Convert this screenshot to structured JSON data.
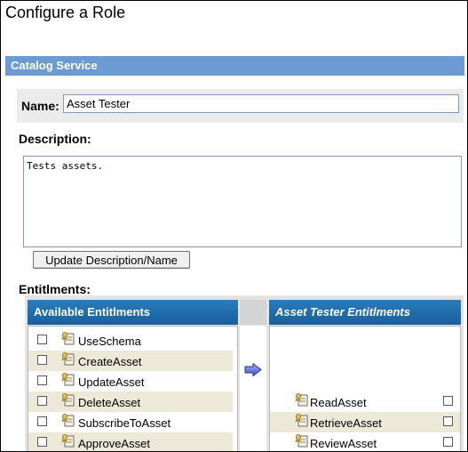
{
  "page_title": "Configure a Role",
  "section_title": "Catalog Service",
  "name": {
    "label": "Name:",
    "value": "Asset Tester"
  },
  "description": {
    "label": "Description:",
    "value": "Tests assets."
  },
  "update_button": "Update Description/Name",
  "entitlements": {
    "label": "Entitlments:",
    "available_title": "Available Entitlments",
    "assigned_title": "Asset Tester Entitlments",
    "available": [
      "UseSchema",
      "CreateAsset",
      "UpdateAsset",
      "DeleteAsset",
      "SubscribeToAsset",
      "ApproveAsset"
    ],
    "assigned": [
      "ReadAsset",
      "RetrieveAsset",
      "ReviewAsset"
    ],
    "move_icon": "arrow-right-icon",
    "item_icon": "entitlement-icon"
  },
  "colors": {
    "section_bar": "#6b9bd2",
    "panel_header": "#1f6aad",
    "row_alt": "#ece9d8"
  }
}
